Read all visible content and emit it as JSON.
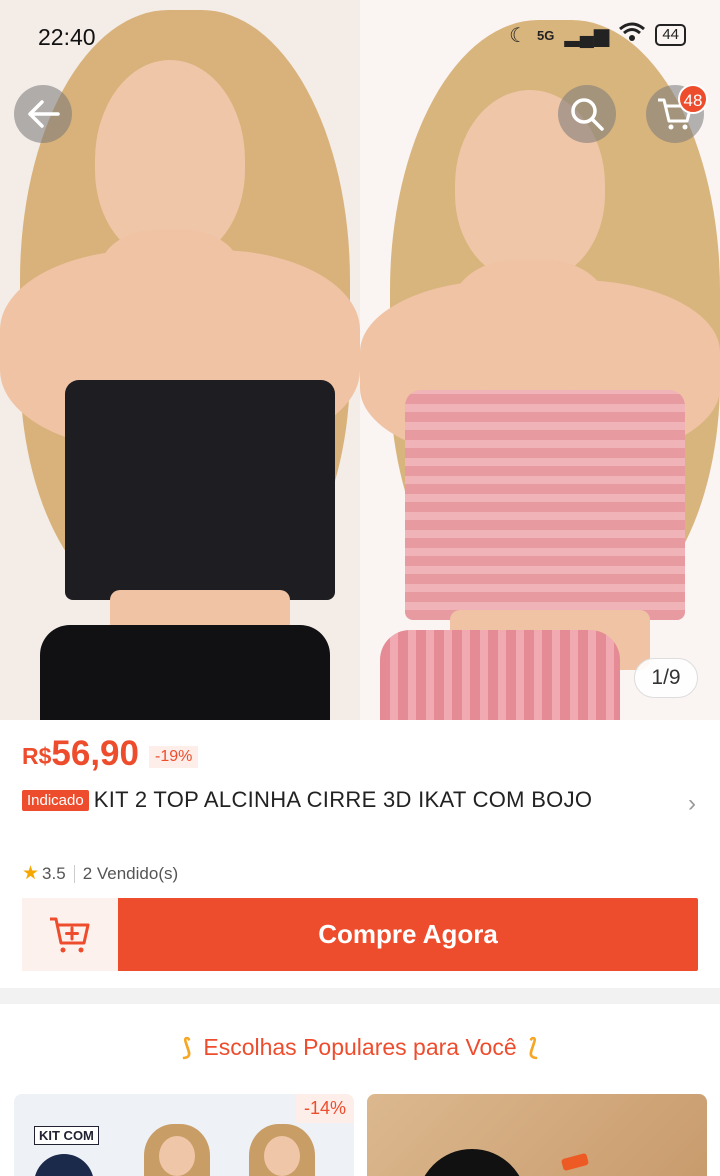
{
  "status_bar": {
    "time": "22:40",
    "network": "5G",
    "battery": "44"
  },
  "header": {
    "cart_count": "48"
  },
  "gallery": {
    "counter": "1/9"
  },
  "product": {
    "currency": "R$",
    "price": "56,90",
    "discount": "-19%",
    "tag": "Indicado",
    "title": "KIT 2 TOP ALCINHA CIRRE 3D IKAT COM BOJO",
    "rating": "3.5",
    "sold": "2 Vendido(s)"
  },
  "actions": {
    "buy_now_label": "Compre Agora"
  },
  "popular": {
    "heading": "Escolhas Populares para Você",
    "cards": [
      {
        "label": "KIT COM",
        "discount": "-14%"
      },
      {
        "label": "",
        "discount": ""
      }
    ]
  },
  "colors": {
    "accent": "#ee4d2d",
    "accent_light": "#fdeeea",
    "star": "#f6a700"
  },
  "icons": {
    "back": "arrow-left-icon",
    "search": "search-icon",
    "cart": "cart-icon",
    "add_to_cart": "cart-plus-icon",
    "star": "star-icon",
    "chevron": "chevron-right-icon"
  }
}
